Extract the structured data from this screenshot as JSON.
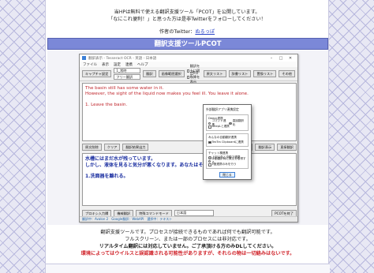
{
  "intro": {
    "line1": "当HPは無料で使える翻訳支援ツール「PCOT」を公開しています。",
    "line2": "「なにこれ便利！」と思った方は是非Twitterをフォローしてください！",
    "author_prefix": "作者のTwitter：",
    "author_link": "ぬるっぽ"
  },
  "section_title": "翻訳支援ツールPCOT",
  "app": {
    "window_title": "翻訳表示 - Tesseract OCR - 英語 - 日本語",
    "menu": [
      "ファイル",
      "表示",
      "設定",
      "連携",
      "ヘルプ"
    ],
    "toolbar": {
      "capture_settings": "キャプチャ設定",
      "mode_select": "1_常時",
      "mode_select2": "フリー翻訳",
      "translate": "翻訳",
      "capture_area": "画像範囲選択",
      "chk_left_top": "翻訳を上に固定",
      "chk_alt": "2枚目以降を表示",
      "btn_src_list": "原文リスト",
      "btn_dict": "辞書リスト",
      "btn_replace": "置換リスト",
      "btn_option": "その他"
    },
    "source_text": [
      "The basin still has some water in it.",
      "However, the sight of the liquid now makes you feel ill. You leave it alone.",
      "1. Leave the basin."
    ],
    "middle_buttons": {
      "reset": "原文削除",
      "clear": "クリア",
      "auto": "翻訳結果出力",
      "bt1": "原文表示",
      "bt2": "翻訳表示",
      "bt3": "直接翻訳"
    },
    "target_text": [
      "水槽にはまだ水が残っています。",
      "しかし、液体を見ると気分が悪くなります。あなたはそれを放っておきます。",
      "1.洗面器を離れる。"
    ],
    "bottom": {
      "proxy": "プロキシ入力欄",
      "paste": "機械翻訳",
      "special": "特殊コマンドモード",
      "lang": "日本語",
      "finish": "PCOTを終了"
    },
    "status": [
      "翻訳中：Avalon 2",
      "Google翻訳：WebAPI",
      "選択中：テキスト"
    ]
  },
  "dialog": {
    "title": "外部翻訳アプリ連携設定",
    "deepl_label": "DeepL連携",
    "deepl_opt1": "コマンド連携",
    "deepl_opt2": "直接翻訳化",
    "deepl_chk": "DeepLと連携",
    "tts_label": "みんなの自動翻訳連携",
    "tts_chk": "TexTra Clipboardに連携",
    "chat_label": "チャット欄連携",
    "chat_opt1": "上記以外と自動で連携",
    "chat_opt2": "手動翻訳時に原文を取得する",
    "chat_opt3": "1度連携のみを行う",
    "close": "閉じる"
  },
  "outro": {
    "line1": "翻訳支援ツールです。プロセスが接続できるものであれば何でも翻訳可能です。",
    "line2": "フルスクリーン、または一部のプロセスには非対応です。",
    "line3": "リアルタイム翻訳には対応していません。ご了承頂ける方のみDLしてください。",
    "warning": "環境によってはウイルスと誤認識される可能性がありますが、それらの物は一切絡みはないです。"
  }
}
